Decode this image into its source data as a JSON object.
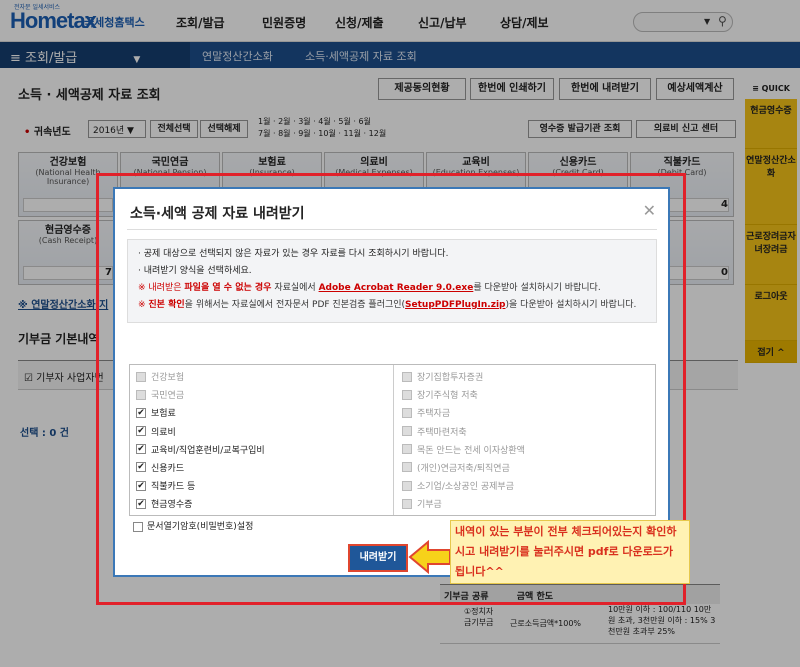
{
  "header": {
    "logo": "Hometax",
    "logo_sub": "전자문 일세서비스",
    "brand": "국세청홈택스",
    "nav": [
      "조회/발급",
      "민원증명",
      "신청/제출",
      "신고/납부",
      "상담/제보"
    ]
  },
  "breadcrumb": {
    "menu": "조회/발급",
    "items": [
      "연말정산간소화",
      "소득·세액공제 자료 조회"
    ]
  },
  "page": {
    "title": "소득 · 세액공제 자료 조회",
    "top_buttons": [
      "제공동의현황",
      "한번에 인쇄하기",
      "한번에 내려받기",
      "예상세액계산"
    ],
    "year_label": "귀속년도",
    "year_value": "2016년",
    "select_all": "전체선택",
    "deselect": "선택해제",
    "months": [
      "1월",
      "2월",
      "3월",
      "4월",
      "5월",
      "6월",
      "7월",
      "8월",
      "9월",
      "10월",
      "11월",
      "12월"
    ],
    "receipt_btn": "영수증 발급기관 조회",
    "medical_btn": "의료비 신고 센터",
    "categories": [
      {
        "ko": "건강보험",
        "en": "(National Health Insurance)"
      },
      {
        "ko": "국민연금",
        "en": "(National Pension)"
      },
      {
        "ko": "보험료",
        "en": "(Insurance)"
      },
      {
        "ko": "의료비",
        "en": "(Medical Expenses)"
      },
      {
        "ko": "교육비",
        "en": "(Education Expenses)"
      },
      {
        "ko": "신용카드",
        "en": "(Credit Card)"
      },
      {
        "ko": "직불카드",
        "en": "(Debit Card)"
      }
    ],
    "cash_ko": "현금영수증",
    "cash_en": "(Cash Receipt)",
    "link": "※ 연말정산간소화 지",
    "donation_title": "기부금 기본내역",
    "donor": "기부자 사업자번",
    "select_count": "선택 : 0 건",
    "table_head": [
      "기부금 공류",
      "금액 한도"
    ],
    "table_row": [
      "①정치자금기부금",
      "근로소득금액*100%",
      "10만원 이하 : 100/110 10만원 초과, 3천만원 이하 : 15% 3천만원 초과부 25%"
    ],
    "val_4": "4",
    "val_7": "7",
    "val_0": "0"
  },
  "quick": {
    "title": "≡ QUICK",
    "items": [
      "현금영수증",
      "연말정산간소화",
      "근로장려금자녀장려금",
      "로그아웃",
      "접기 ^"
    ]
  },
  "modal": {
    "title": "소득·세액 공제 자료 내려받기",
    "notice": [
      "· 공제 대상으로 선택되지 않은 자료가 있는 경우 자료를 다시 조회하시기 바랍니다.",
      "· 내려받기 양식을 선택하세요."
    ],
    "n3a": "※ 내려받은 ",
    "n3b": "파일을 열 수 없는 경우",
    "n3c": " 자료실에서 ",
    "n3d": "Adobe Acrobat Reader 9.0.exe",
    "n3e": "를 다운받아 설치하시기 바랍니다.",
    "n4a": "※ ",
    "n4b": "진본 확인",
    "n4c": "을 위해서는 자료실에서 전자문서 PDF 진본검증 플러그인(",
    "n4d": "SetupPDFPlugIn.zip",
    "n4e": ")을 다운받아 설치하시기 바랍니다.",
    "left": [
      {
        "t": "건강보험",
        "c": false,
        "d": true
      },
      {
        "t": "국민연금",
        "c": false,
        "d": true
      },
      {
        "t": "보험료",
        "c": true,
        "d": false
      },
      {
        "t": "의료비",
        "c": true,
        "d": false
      },
      {
        "t": "교육비/직업훈련비/교복구입비",
        "c": true,
        "d": false
      },
      {
        "t": "신용카드",
        "c": true,
        "d": false
      },
      {
        "t": "직불카드 등",
        "c": true,
        "d": false
      },
      {
        "t": "현금영수증",
        "c": true,
        "d": false
      }
    ],
    "right": [
      {
        "t": "장기집합투자증권",
        "c": false,
        "d": true
      },
      {
        "t": "장기주식형 저축",
        "c": false,
        "d": true
      },
      {
        "t": "주택자금",
        "c": false,
        "d": true
      },
      {
        "t": "주택마련저축",
        "c": false,
        "d": true
      },
      {
        "t": "목돈 안드는 전세 이자상환액",
        "c": false,
        "d": true
      },
      {
        "t": "(개인)연금저축/퇴직연금",
        "c": false,
        "d": true
      },
      {
        "t": "소기업/소상공인 공제부금",
        "c": false,
        "d": true
      },
      {
        "t": "기부금",
        "c": false,
        "d": true
      }
    ],
    "pwd": "문서열기암호(비밀번호)설정",
    "download": "내려받기"
  },
  "tip": "내역이 있는 부분이 전부 체크되어있는지 확인하시고 내려받기를 눌러주시면 pdf로 다운로드가 됩니다^^"
}
